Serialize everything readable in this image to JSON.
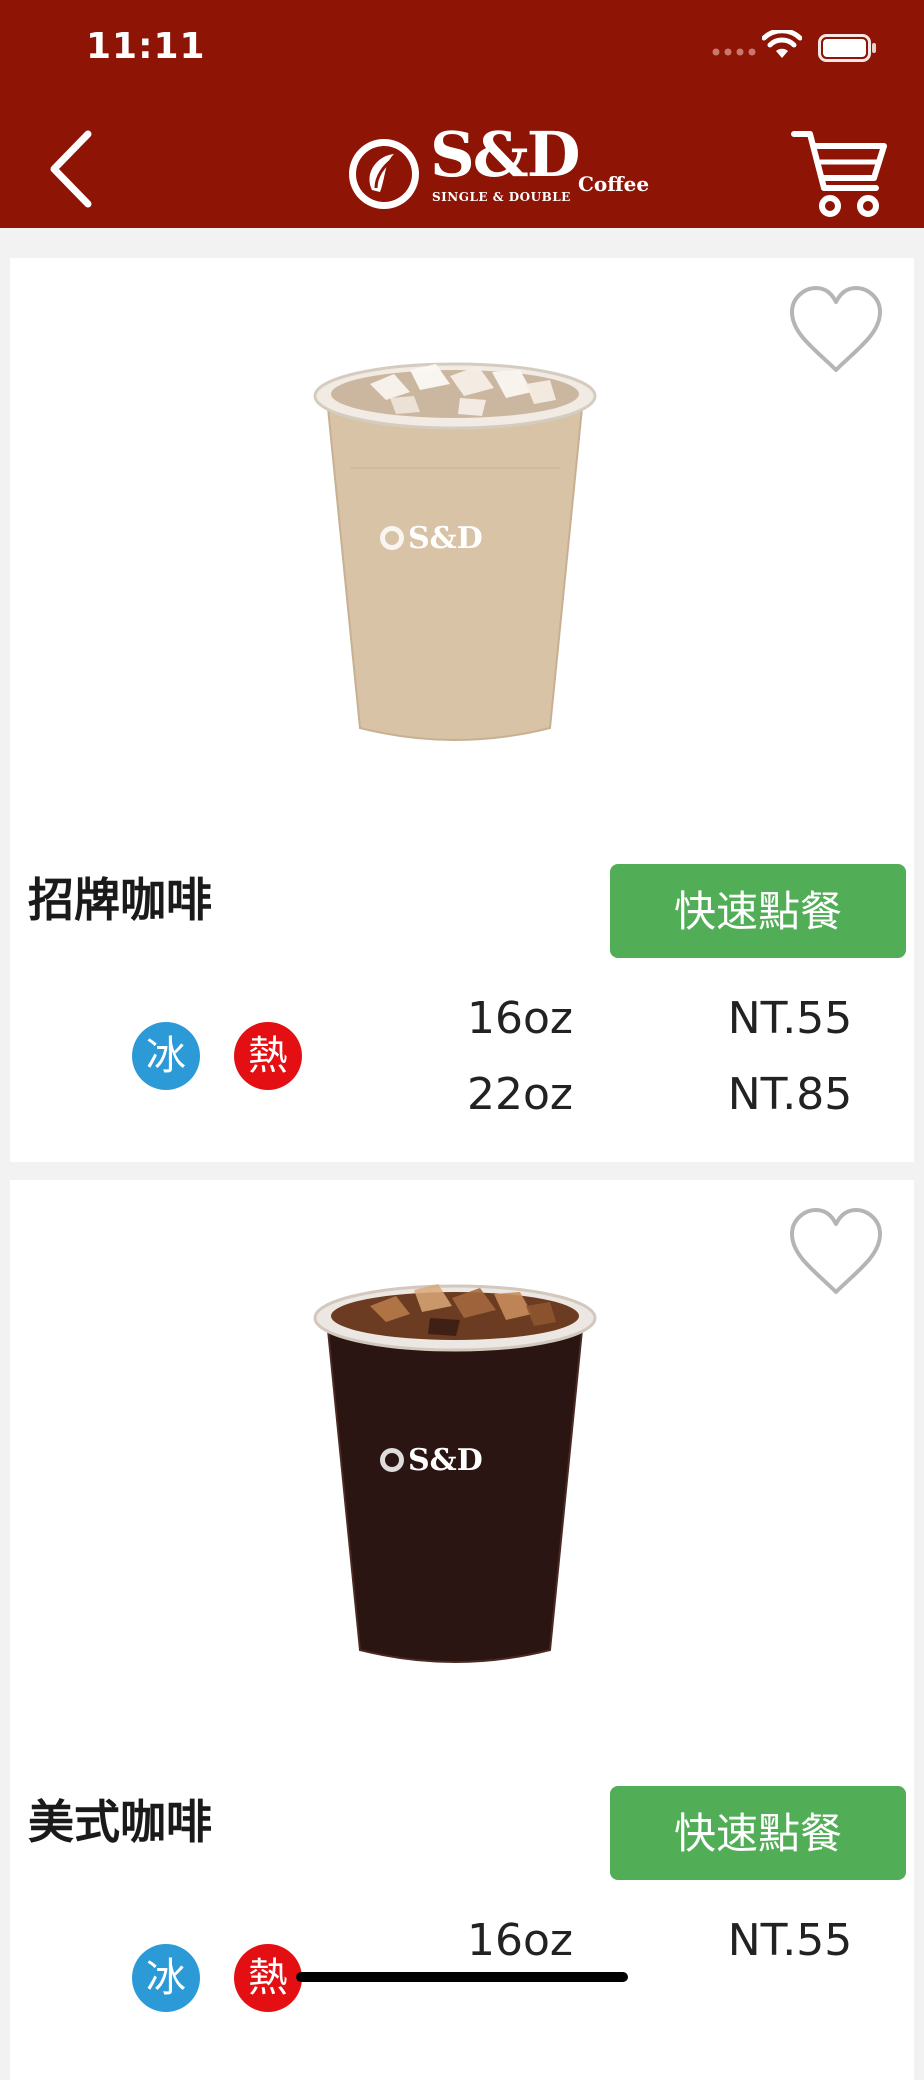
{
  "status_bar": {
    "time": "11:11"
  },
  "header": {
    "logo_main": "S&D",
    "logo_sub": "SINGLE & DOUBLE",
    "logo_coffee": "Coffee",
    "logo_emblem_text": "Single & Double"
  },
  "colors": {
    "header_bg": "#8e1405",
    "quick_order_bg": "#52ad57",
    "ice_badge": "#2d9ad8",
    "hot_badge": "#e40f12"
  },
  "products": [
    {
      "name": "招牌咖啡",
      "quick_order_label": "快速點餐",
      "temps": {
        "ice": "冰",
        "hot": "熱"
      },
      "sizes": [
        {
          "size": "16oz",
          "price": "NT.55"
        },
        {
          "size": "22oz",
          "price": "NT.85"
        }
      ],
      "image": "latte-cup-image",
      "cup_logo": "S&D"
    },
    {
      "name": "美式咖啡",
      "quick_order_label": "快速點餐",
      "temps": {
        "ice": "冰",
        "hot": "熱"
      },
      "sizes": [
        {
          "size": "16oz",
          "price": "NT.55"
        }
      ],
      "image": "americano-cup-image",
      "cup_logo": "S&D"
    }
  ]
}
